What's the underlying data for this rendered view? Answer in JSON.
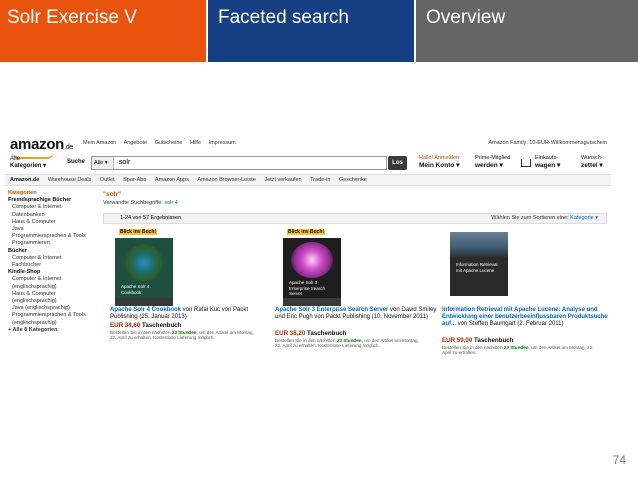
{
  "slide": {
    "headers": [
      "Solr Exercise V",
      "Faceted search",
      "Overview"
    ],
    "colors": {
      "orange": "#e8530e",
      "blue": "#163f84",
      "gray": "#656565"
    },
    "page_number": "74"
  },
  "amazon": {
    "logo": "amazon",
    "logo_suffix": ".de",
    "top_links": [
      "Mein Amazon",
      "Angebote",
      "Gutscheine",
      "Hilfe",
      "Impressum"
    ],
    "family": "Amazon Family: 10-EUR-Willkommensgutschein",
    "categories_line1": "Alle",
    "categories_line2": "Kategorien ▾",
    "search_label": "Suche",
    "search_scope": "Alle ▾",
    "search_value": "solr",
    "go_button": "Los",
    "greeting": "Hallo! Anmelden",
    "account": "Mein Konto ▾",
    "prime_line1": "Prime-Mitglied",
    "prime_line2": "werden ▾",
    "cart_line1": "Einkaufs-",
    "cart_line2": "wagen ▾",
    "wish_line1": "Wunsch-",
    "wish_line2": "zettel ▾",
    "nav": [
      "Amazon.de",
      "Warehouse Deals",
      "Outlet",
      "Spar-Abo",
      "Amazon Apps",
      "Amazon Browser-Leiste",
      "Jetzt verkaufen",
      "Trade-in",
      "Geschenke"
    ],
    "sidebar": [
      {
        "type": "h orange",
        "text": "Kategorien"
      },
      {
        "type": "h",
        "text": "Fremdsprachige Bücher"
      },
      {
        "type": "i",
        "text": "Computer & Internet"
      },
      {
        "type": "i",
        "text": "Datenbanken"
      },
      {
        "type": "i",
        "text": "Haus & Computer"
      },
      {
        "type": "i",
        "text": "Java"
      },
      {
        "type": "i",
        "text": "Programmiersprachen & Tools"
      },
      {
        "type": "i",
        "text": "Programmieren"
      },
      {
        "type": "h",
        "text": "Bücher"
      },
      {
        "type": "i",
        "text": "Computer & Internet"
      },
      {
        "type": "i",
        "text": "Fachbücher"
      },
      {
        "type": "h",
        "text": "Kindle-Shop"
      },
      {
        "type": "i",
        "text": "Computer & Internet"
      },
      {
        "type": "i",
        "text": "(englischsprachig)"
      },
      {
        "type": "i",
        "text": "Haus & Computer"
      },
      {
        "type": "i",
        "text": "(englischsprachig)"
      },
      {
        "type": "i",
        "text": "Java (englischsprachig)"
      },
      {
        "type": "i",
        "text": "Programmiersprachen & Tools"
      },
      {
        "type": "i",
        "text": "(englischsprachig)"
      },
      {
        "type": "more",
        "text": "+ Alle 8 Kategorien"
      }
    ],
    "query": "\"solr\"",
    "related_label": "Verwandte Suchbegriffe:",
    "related_link": "solr 4",
    "result_count": "1-24 von 57 Ergebnissen",
    "sort_label": "Wählen Sie zum Sortieren eine:",
    "sort_value": "Kategorie ▾",
    "blick": "Blick ins Buch!",
    "products": [
      {
        "cover_title": "Apache Solr 4 Cookbook",
        "title": "Apache Solr 4 Cookbook",
        "rest": " von Rafał Kuc von Packt Publishing (25. Januar 2013)",
        "price": "EUR 34,60",
        "format": "Taschenbuch",
        "ship1": "Bestellen Sie in den nächsten",
        "hours": "23 Stunden",
        "ship2": ", um den Artikel am Montag, 22. April zu erhalten.",
        "ship3": "Kostenlose Lieferung möglich."
      },
      {
        "cover_title": "Apache Solr 3 Enterprise Search Server",
        "title": "Apache Solr 3 Enterprise Search Server",
        "rest": " von David Smiley und Eric Pugh von Packt Publishing (10. November 2011)",
        "price": "EUR 38,20",
        "format": "Taschenbuch",
        "ship1": "Bestellen Sie in den nächsten",
        "hours": "23 Stunden",
        "ship2": ", um den Artikel am Montag, 22. April zu erhalten.",
        "ship3": "Kostenlose Lieferung möglich."
      },
      {
        "cover_title": "Information Retrieval mit Apache Lucene",
        "title": "Information Retrieval mit Apache Lucene: Analyse und Entwicklung einer benutzerbeeinflussbaren Produktsuche auf...",
        "rest": " von Steffen Baumgart (2. Februar 2011)",
        "price": "EUR 59,00",
        "format": "Taschenbuch",
        "ship1": "Bestellen Sie in den nächsten",
        "hours": "23 Stunden",
        "ship2": ", um den Artikel am Montag, 22. April zu erhalten.",
        "ship3": ""
      }
    ]
  }
}
